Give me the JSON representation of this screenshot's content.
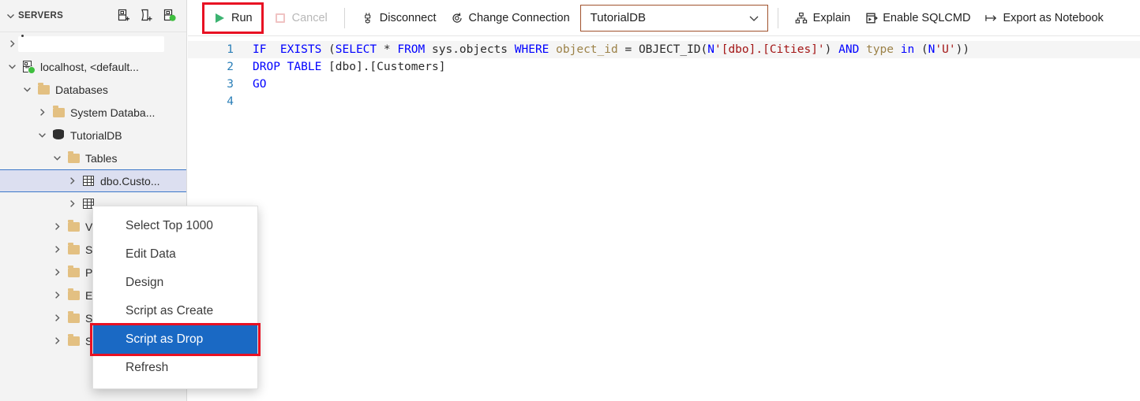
{
  "sidebar": {
    "title": "SERVERS",
    "collapse_icon": "chevron-down-icon",
    "actions": [
      {
        "name": "new-connection-icon",
        "tooltip": "New Connection"
      },
      {
        "name": "new-server-group-icon",
        "tooltip": "New Server Group"
      },
      {
        "name": "connect-server-icon",
        "tooltip": "Connect"
      }
    ],
    "tree": [
      {
        "label": "",
        "indent": 0,
        "twist": "chevron-right-icon",
        "icon": "none",
        "redacted": true,
        "selected": false
      },
      {
        "label": "localhost, <default...",
        "indent": 0,
        "twist": "chevron-down-icon",
        "icon": "server-icon",
        "redacted": false,
        "selected": false
      },
      {
        "label": "Databases",
        "indent": 1,
        "twist": "chevron-down-icon",
        "icon": "folder-icon",
        "redacted": false,
        "selected": false
      },
      {
        "label": "System Databa...",
        "indent": 2,
        "twist": "chevron-right-icon",
        "icon": "folder-icon",
        "redacted": false,
        "selected": false
      },
      {
        "label": "TutorialDB",
        "indent": 2,
        "twist": "chevron-down-icon",
        "icon": "database-icon",
        "redacted": false,
        "selected": false
      },
      {
        "label": "Tables",
        "indent": 3,
        "twist": "chevron-down-icon",
        "icon": "folder-icon",
        "redacted": false,
        "selected": false
      },
      {
        "label": "dbo.Custo...",
        "indent": 4,
        "twist": "chevron-right-icon",
        "icon": "table-icon",
        "redacted": false,
        "selected": true
      },
      {
        "label": "",
        "indent": 4,
        "twist": "chevron-right-icon",
        "icon": "table-icon",
        "redacted": false,
        "selected": false
      },
      {
        "label": "V",
        "indent": 3,
        "twist": "chevron-right-icon",
        "icon": "folder-icon",
        "redacted": false,
        "selected": false
      },
      {
        "label": "S",
        "indent": 3,
        "twist": "chevron-right-icon",
        "icon": "folder-icon",
        "redacted": false,
        "selected": false
      },
      {
        "label": "P",
        "indent": 3,
        "twist": "chevron-right-icon",
        "icon": "folder-icon",
        "redacted": false,
        "selected": false
      },
      {
        "label": "E",
        "indent": 3,
        "twist": "chevron-right-icon",
        "icon": "folder-icon",
        "redacted": false,
        "selected": false
      },
      {
        "label": "S",
        "indent": 3,
        "twist": "chevron-right-icon",
        "icon": "folder-icon",
        "redacted": false,
        "selected": false
      },
      {
        "label": "S",
        "indent": 3,
        "twist": "chevron-right-icon",
        "icon": "folder-icon",
        "redacted": false,
        "selected": false
      }
    ]
  },
  "toolbar": {
    "run_label": "Run",
    "run_icon": "play-triangle-icon",
    "run_highlight_color": "#e81123",
    "cancel_label": "Cancel",
    "cancel_icon": "stop-square-icon",
    "cancel_disabled": true,
    "disconnect_label": "Disconnect",
    "disconnect_icon": "disconnect-plug-icon",
    "change_connection_label": "Change Connection",
    "change_connection_icon": "refresh-connection-icon",
    "database_value": "TutorialDB",
    "database_dropdown_icon": "chevron-down-icon",
    "database_border_color": "#a0522d",
    "explain_label": "Explain",
    "explain_icon": "plan-tree-icon",
    "sqlcmd_label": "Enable SQLCMD",
    "sqlcmd_icon": "sqlcmd-terminal-icon",
    "export_label": "Export as Notebook",
    "export_icon": "export-arrow-icon"
  },
  "editor": {
    "line_numbers": [
      "1",
      "2",
      "3",
      "4"
    ],
    "lines": [
      [
        {
          "t": "IF  EXISTS ",
          "c": "kw"
        },
        {
          "t": "(",
          "c": "pn"
        },
        {
          "t": "SELECT ",
          "c": "kw"
        },
        {
          "t": "* ",
          "c": "pn"
        },
        {
          "t": "FROM ",
          "c": "kw"
        },
        {
          "t": "sys.objects ",
          "c": "id"
        },
        {
          "t": "WHERE ",
          "c": "kw"
        },
        {
          "t": "object_id ",
          "c": "col"
        },
        {
          "t": "= ",
          "c": "pn"
        },
        {
          "t": "OBJECT_ID",
          "c": "id"
        },
        {
          "t": "(",
          "c": "pn"
        },
        {
          "t": "N",
          "c": "kw"
        },
        {
          "t": "'[dbo].[Cities]'",
          "c": "str"
        },
        {
          "t": ") ",
          "c": "pn"
        },
        {
          "t": "AND ",
          "c": "kw"
        },
        {
          "t": "type ",
          "c": "col"
        },
        {
          "t": "in ",
          "c": "kw"
        },
        {
          "t": "(",
          "c": "pn"
        },
        {
          "t": "N",
          "c": "kw"
        },
        {
          "t": "'U'",
          "c": "str"
        },
        {
          "t": "))",
          "c": "pn"
        }
      ],
      [
        {
          "t": "DROP TABLE ",
          "c": "kw"
        },
        {
          "t": "[dbo].[Customers]",
          "c": "pn"
        }
      ],
      [
        {
          "t": "GO",
          "c": "kw"
        }
      ],
      []
    ],
    "plain_text": "IF  EXISTS (SELECT * FROM sys.objects WHERE object_id = OBJECT_ID(N'[dbo].[Cities]') AND type in (N'U'))\nDROP TABLE [dbo].[Customers]\nGO\n"
  },
  "context_menu": {
    "items": [
      {
        "label": "Select Top 1000",
        "active": false
      },
      {
        "label": "Edit Data",
        "active": false
      },
      {
        "label": "Design",
        "active": false
      },
      {
        "label": "Script as Create",
        "active": false
      },
      {
        "label": "Script as Drop",
        "active": true
      },
      {
        "label": "Refresh",
        "active": false
      }
    ],
    "highlighted_item_index": 4,
    "highlight_color": "#e81123",
    "active_bg_color": "#1a69c4"
  }
}
